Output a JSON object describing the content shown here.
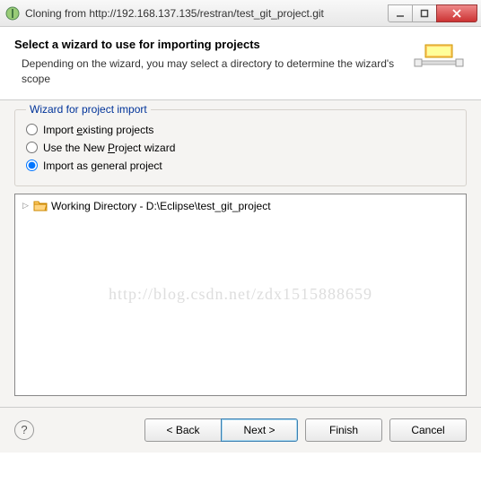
{
  "window": {
    "title": "Cloning from http://192.168.137.135/restran/test_git_project.git"
  },
  "header": {
    "title": "Select a wizard to use for importing projects",
    "desc": "Depending on the wizard, you may select a directory to determine the wizard's scope"
  },
  "group": {
    "legend": "Wizard for project import",
    "options": [
      {
        "label_pre": "Import ",
        "u": "e",
        "label_post": "xisting projects",
        "checked": false
      },
      {
        "label_pre": "Use the New ",
        "u": "P",
        "label_post": "roject wizard",
        "checked": false
      },
      {
        "label_pre": "Import as ",
        "u": "g",
        "label_post": "eneral project",
        "checked": true
      }
    ]
  },
  "tree": {
    "items": [
      {
        "label": "Working Directory - D:\\Eclipse\\test_git_project"
      }
    ]
  },
  "buttons": {
    "back": "< Back",
    "next": "Next >",
    "finish": "Finish",
    "cancel": "Cancel"
  },
  "watermark": "http://blog.csdn.net/zdx1515888659"
}
